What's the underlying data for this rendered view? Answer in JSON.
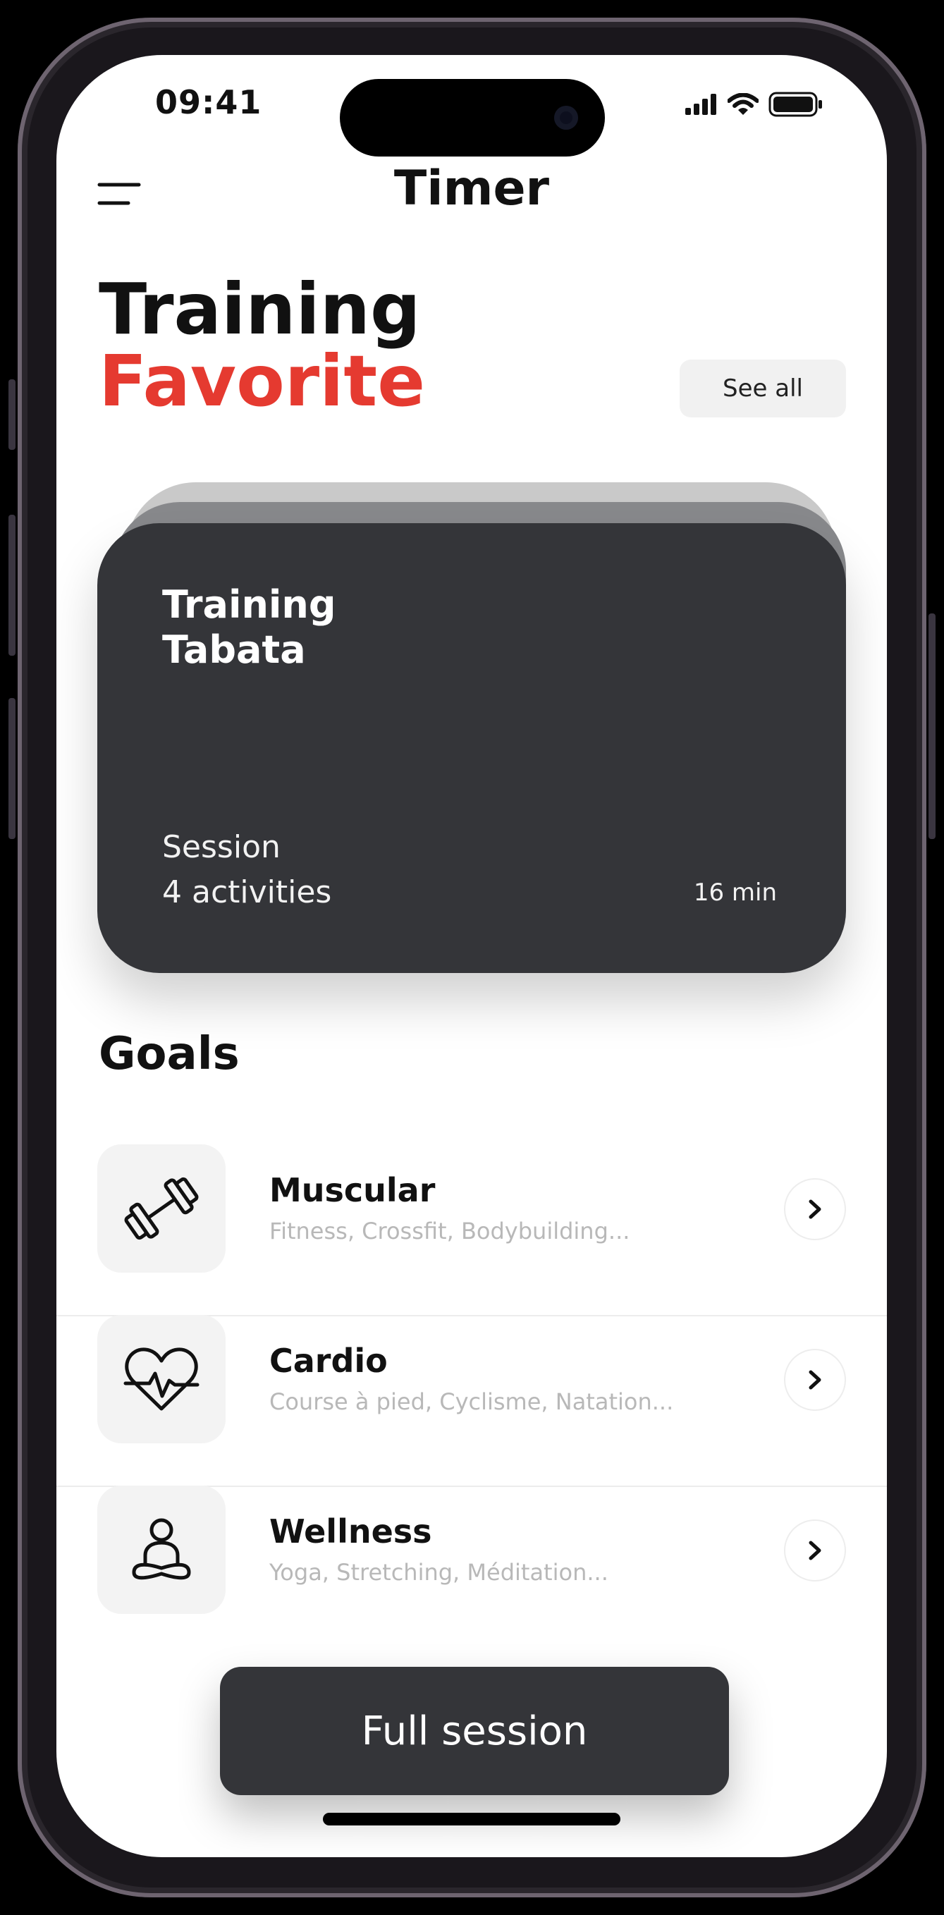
{
  "status_bar": {
    "time": "09:41"
  },
  "header": {
    "title": "Timer"
  },
  "favorites": {
    "title_line1": "Training",
    "title_line2": "Favorite",
    "see_all_label": "See all",
    "accent_color": "#e53a30"
  },
  "card": {
    "title_line1": "Training",
    "title_line2": "Tabata",
    "subtitle_line1": "Session",
    "subtitle_line2": "4 activities",
    "duration": "16 min",
    "background_color": "#343539"
  },
  "goals": {
    "title": "Goals",
    "items": [
      {
        "name": "Muscular",
        "description": "Fitness, Crossfit, Bodybuilding...",
        "icon": "dumbbell-icon"
      },
      {
        "name": "Cardio",
        "description": "Course à pied, Cyclisme, Natation...",
        "icon": "heart-pulse-icon"
      },
      {
        "name": "Wellness",
        "description": "Yoga, Stretching, Méditation...",
        "icon": "meditation-icon"
      }
    ]
  },
  "cta": {
    "label": "Full session"
  }
}
